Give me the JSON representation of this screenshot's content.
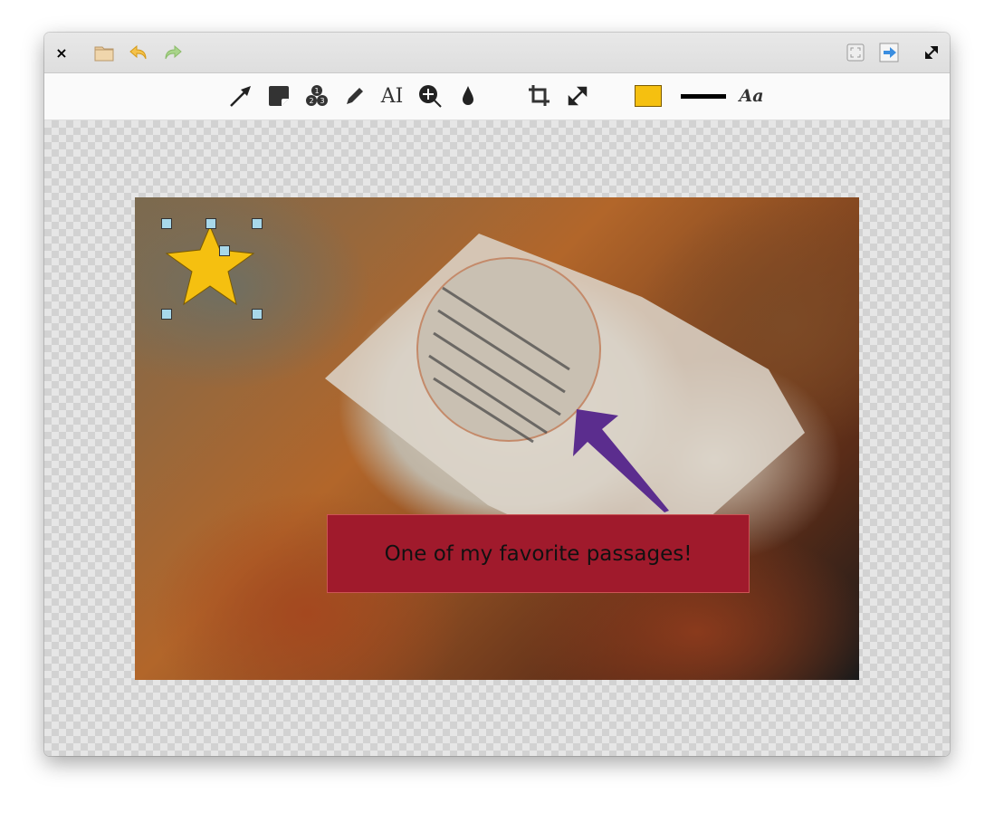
{
  "titlebar": {
    "close": "×",
    "icons": [
      "open-folder-icon",
      "undo-icon",
      "redo-icon",
      "fit-icon",
      "export-icon",
      "fullscreen-icon"
    ]
  },
  "toolbar": {
    "tools": [
      "arrow",
      "sticker",
      "counter",
      "pencil",
      "text",
      "magnifier",
      "blur",
      "crop",
      "resize"
    ],
    "color": "#f5c010",
    "line_color": "#000000",
    "font_label": "Aa"
  },
  "annotation": {
    "text": "One of my favorite passages!",
    "banner_color": "#a01a2c",
    "arrow_color": "#5b2d8e",
    "star_color": "#f5c010"
  }
}
